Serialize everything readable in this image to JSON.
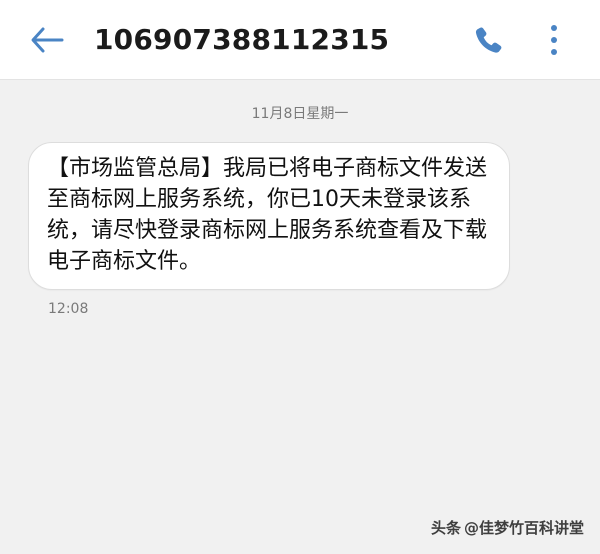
{
  "header": {
    "contact_number": "106907388112315",
    "icons": {
      "back": "back-arrow-icon",
      "call": "phone-icon",
      "more": "more-vertical-icon"
    },
    "accent_color": "#4a84c4"
  },
  "conversation": {
    "date_label": "11月8日星期一",
    "message": {
      "text": "【市场监管总局】我局已将电子商标文件发送至商标网上服务系统，你已10天未登录该系统，请尽快登录商标网上服务系统查看及下载电子商标文件。",
      "time": "12:08"
    }
  },
  "watermark": {
    "brand": "头条",
    "user": "@佳梦竹百科讲堂"
  }
}
